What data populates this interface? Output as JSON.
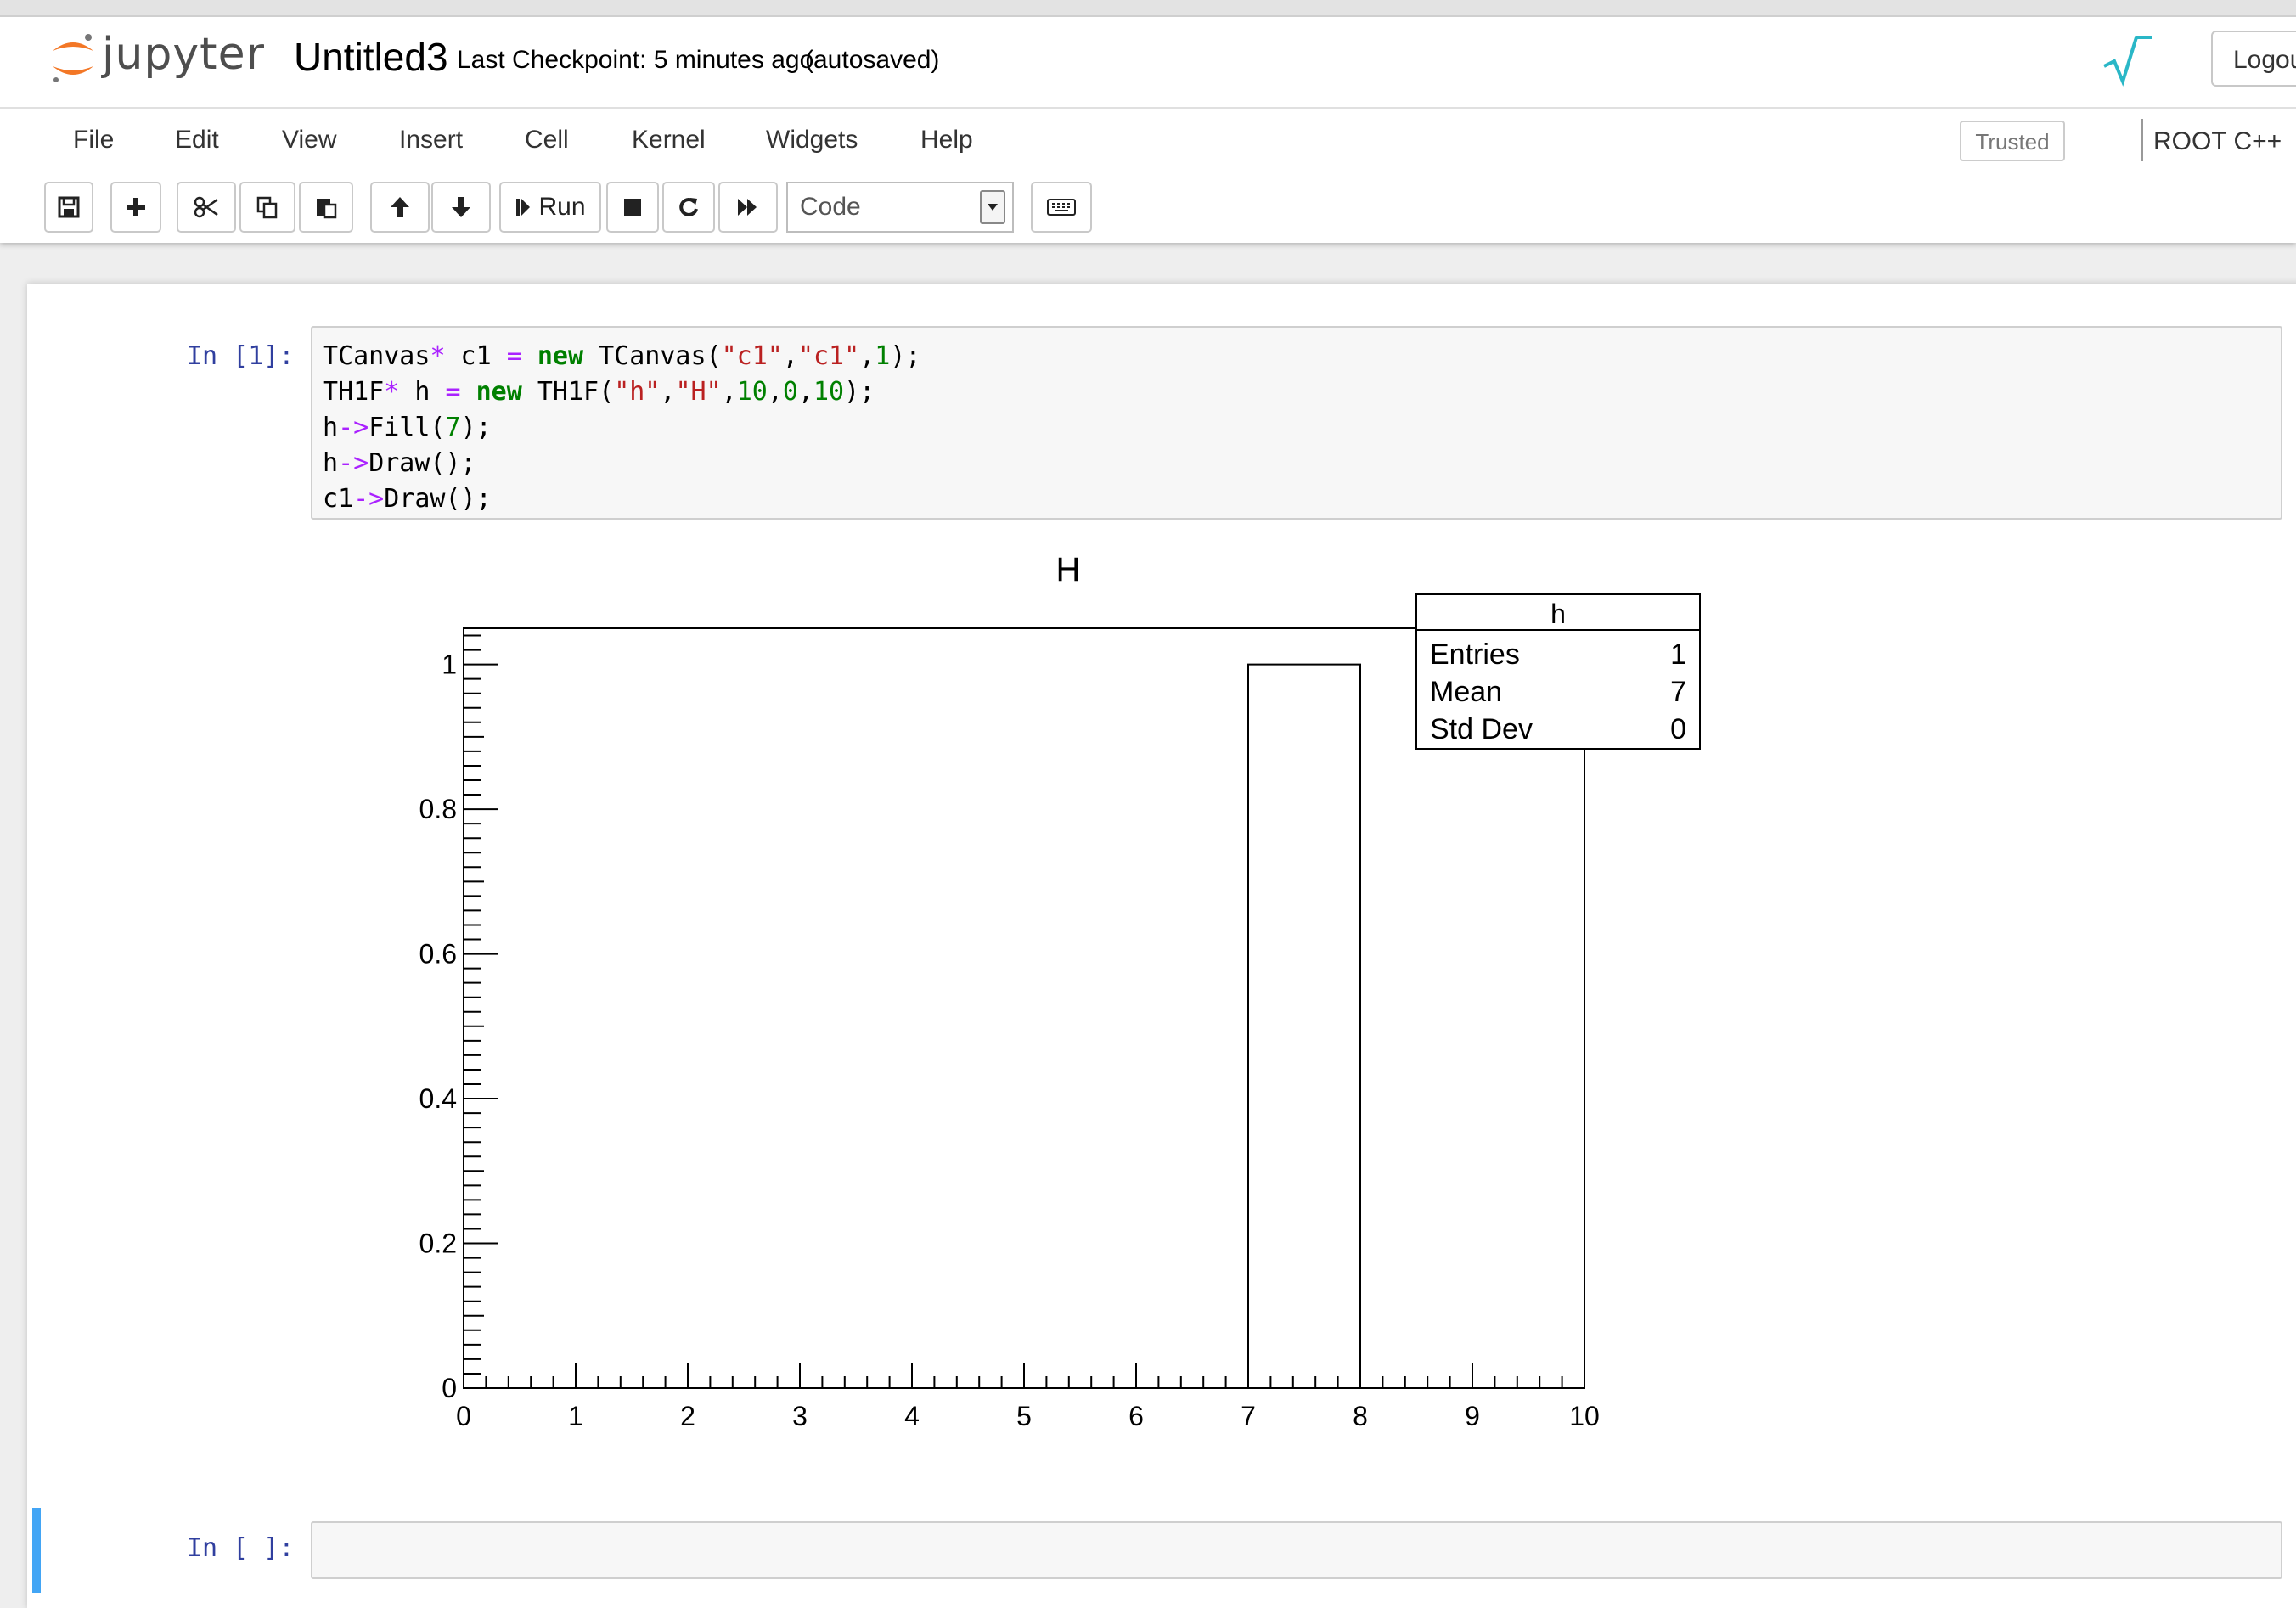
{
  "header": {
    "logo_icon": "jupyter-logo-icon",
    "logo_text": "jupyter",
    "notebook_name": "Untitled3",
    "checkpoint": "Last Checkpoint: 5 minutes ago",
    "autosave": "(autosaved)",
    "root_icon": "root-logo-icon",
    "logout_label": "Logou"
  },
  "menu": {
    "items": [
      "File",
      "Edit",
      "View",
      "Insert",
      "Cell",
      "Kernel",
      "Widgets",
      "Help"
    ],
    "trusted": "Trusted",
    "kernel": "ROOT C++"
  },
  "toolbar": {
    "buttons": [
      "save-icon",
      "add-cell-icon",
      "cut-icon",
      "copy-icon",
      "paste-icon",
      "move-up-icon",
      "move-down-icon",
      "run-button",
      "stop-icon",
      "restart-icon",
      "fast-forward-icon"
    ],
    "run_label": "Run",
    "cell_type": "Code",
    "keyboard_icon": "keyboard-icon"
  },
  "cells": {
    "cell1": {
      "prompt": "In [1]:",
      "code": [
        "TCanvas* c1 = new TCanvas(\"c1\",\"c1\",1);",
        "TH1F* h = new TH1F(\"h\",\"H\",10,0,10);",
        "h->Fill(7);",
        "h->Draw();",
        "c1->Draw();"
      ]
    },
    "cell2": {
      "prompt": "In [ ]:"
    }
  },
  "chart_data": {
    "type": "bar",
    "title": "H",
    "xlabel": "",
    "ylabel": "",
    "bins": [
      [
        0,
        1
      ],
      [
        1,
        2
      ],
      [
        2,
        3
      ],
      [
        3,
        4
      ],
      [
        4,
        5
      ],
      [
        5,
        6
      ],
      [
        6,
        7
      ],
      [
        7,
        8
      ],
      [
        8,
        9
      ],
      [
        9,
        10
      ]
    ],
    "values": [
      0,
      0,
      0,
      0,
      0,
      0,
      0,
      1,
      0,
      0
    ],
    "xlim": [
      0,
      10
    ],
    "ylim": [
      0,
      1.05
    ],
    "x_ticks": [
      "0",
      "1",
      "2",
      "3",
      "4",
      "5",
      "6",
      "7",
      "8",
      "9",
      "10"
    ],
    "y_ticks": [
      "0",
      "0.2",
      "0.4",
      "0.6",
      "0.8",
      "1"
    ],
    "y_tick_values": [
      0,
      0.2,
      0.4,
      0.6,
      0.8,
      1
    ],
    "grid": false,
    "stats_box": {
      "name": "h",
      "rows": [
        {
          "label": "Entries",
          "value": "1"
        },
        {
          "label": "Mean",
          "value": "7"
        },
        {
          "label": "Std Dev",
          "value": "0"
        }
      ],
      "placement": "top-right"
    }
  }
}
